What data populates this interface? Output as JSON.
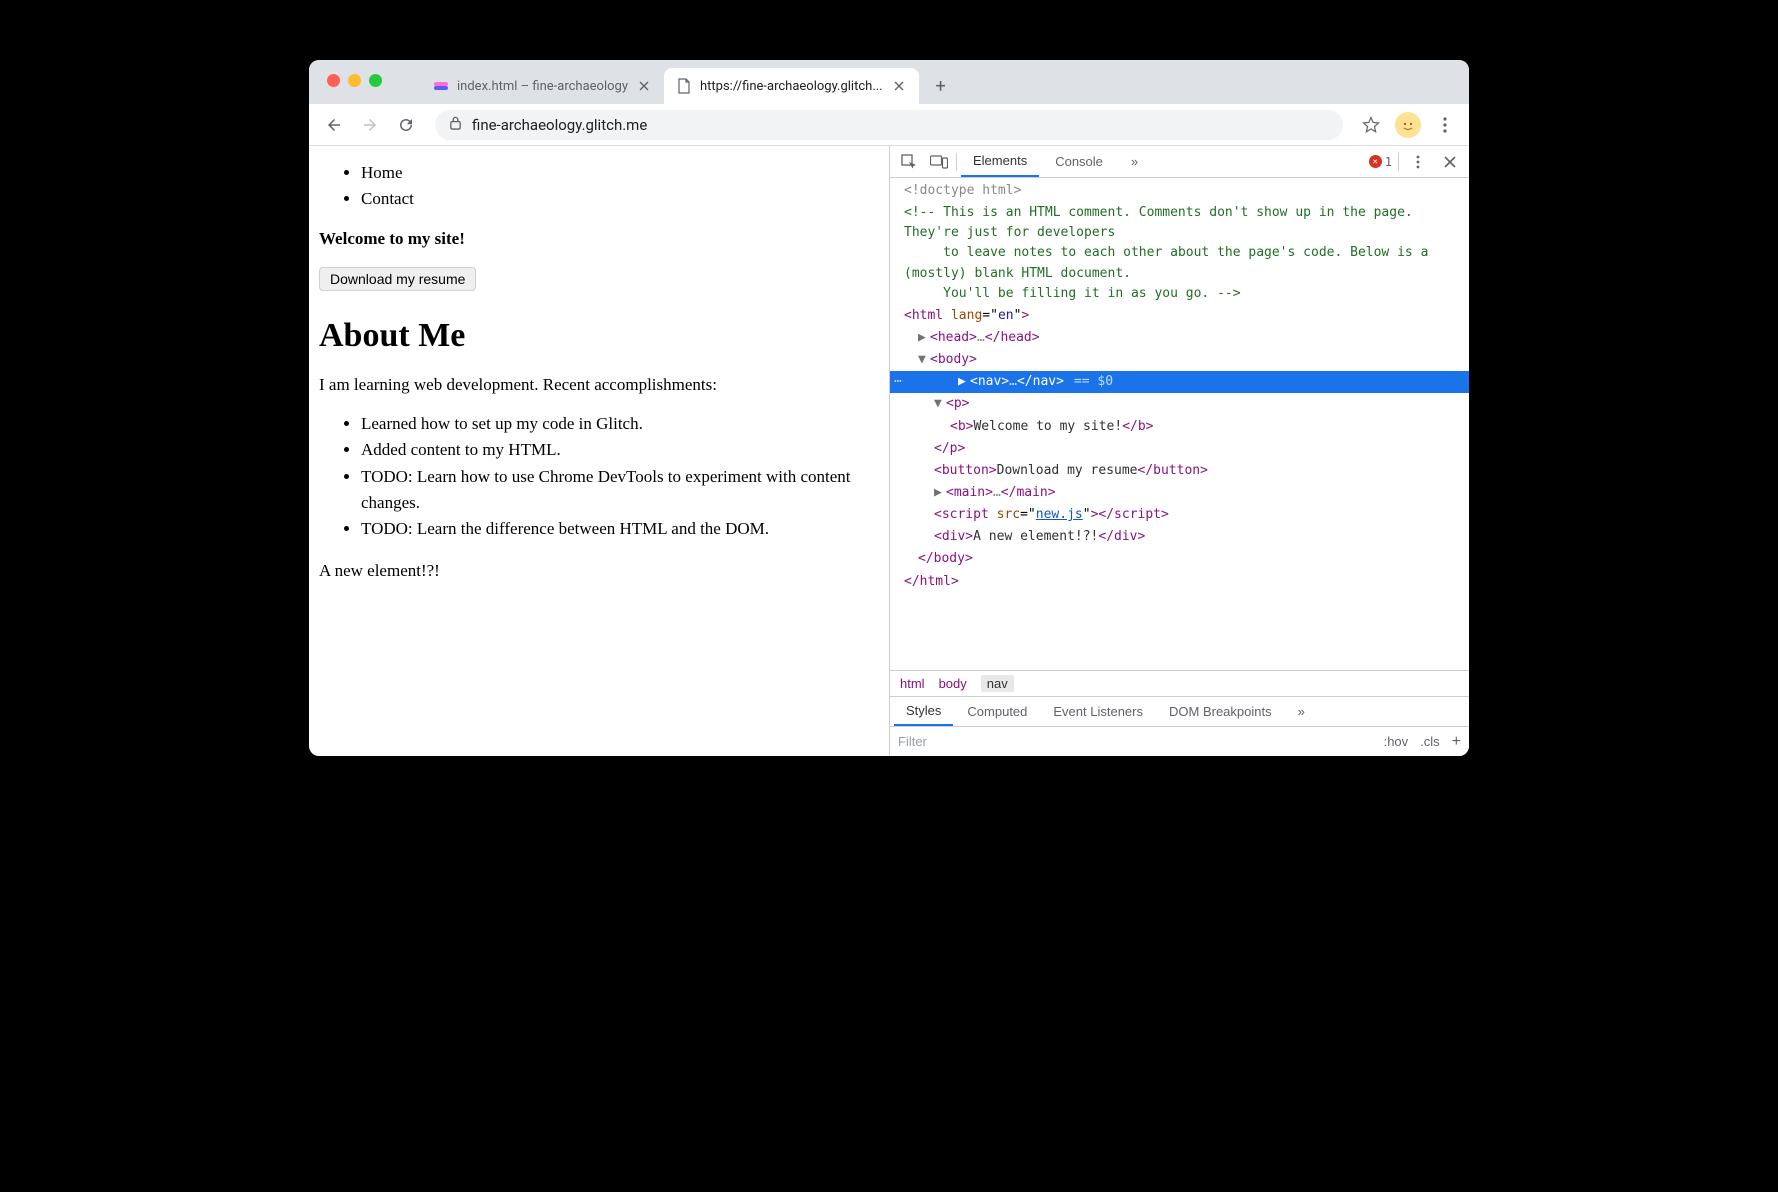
{
  "tabs": [
    {
      "title": "index.html – fine-archaeology"
    },
    {
      "title": "https://fine-archaeology.glitch..."
    }
  ],
  "address_url": "fine-archaeology.glitch.me",
  "page": {
    "nav_items": [
      "Home",
      "Contact"
    ],
    "welcome": "Welcome to my site!",
    "resume_btn": "Download my resume",
    "about_heading": "About Me",
    "intro": "I am learning web development. Recent accomplishments:",
    "accomplishments": [
      "Learned how to set up my code in Glitch.",
      "Added content to my HTML.",
      "TODO: Learn how to use Chrome DevTools to experiment with content changes.",
      "TODO: Learn the difference between HTML and the DOM."
    ],
    "new_element": "A new element!?!"
  },
  "devtools": {
    "tabs": {
      "elements": "Elements",
      "console": "Console",
      "more": "»"
    },
    "errors_count": "1",
    "dom": {
      "doctype": "<!doctype html>",
      "comment": "<!-- This is an HTML comment. Comments don't show up in the page. They're just for developers\n     to leave notes to each other about the page's code. Below is a (mostly) blank HTML document.\n     You'll be filling it in as you go. -->",
      "html_open": "<html lang=\"en\">",
      "head": "<head>…</head>",
      "body_open": "<body>",
      "nav": "<nav>…</nav>",
      "eq0": "== $0",
      "p_open": "<p>",
      "b_welcome": "<b>Welcome to my site!</b>",
      "p_close": "</p>",
      "button": "<button>Download my resume</button>",
      "main": "<main>…</main>",
      "script_src": "new.js",
      "div_new": "<div>A new element!?!</div>",
      "body_close": "</body>",
      "html_close": "</html>"
    },
    "breadcrumb": [
      "html",
      "body",
      "nav"
    ],
    "styles_tabs": {
      "styles": "Styles",
      "computed": "Computed",
      "listeners": "Event Listeners",
      "dom_bp": "DOM Breakpoints",
      "more": "»"
    },
    "filter_placeholder": "Filter",
    "hov": ":hov",
    "cls": ".cls"
  }
}
